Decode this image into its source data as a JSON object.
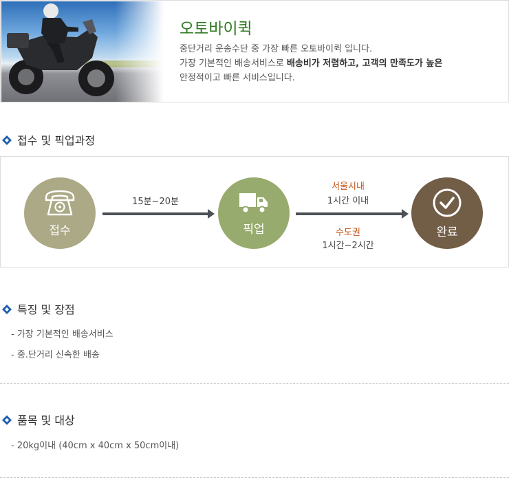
{
  "hero": {
    "title": "오토바이퀵",
    "desc_line1": "중단거리 운송수단 중 가장 빠른 오토바이퀵 입니다.",
    "desc_line2_plain": "가장 기본적인 배송서비스로 ",
    "desc_line2_bold": "배송비가 저렴하고, 고객의 만족도가 높은",
    "desc_line3": "안정적이고 빠른 서비스입니다."
  },
  "sections": {
    "process_title": "접수 및 픽업과정",
    "features_title": "특징 및 장점",
    "items_title": "품목 및 대상"
  },
  "process": {
    "steps": [
      {
        "label": "접수",
        "icon": "telephone-icon",
        "color": "#aba986"
      },
      {
        "label": "픽업",
        "icon": "truck-icon",
        "color": "#98ab6e"
      },
      {
        "label": "완료",
        "icon": "check-circle-icon",
        "color": "#725d47"
      }
    ],
    "arrow1_time": "15분~20분",
    "arrow2_top_title": "서울시내",
    "arrow2_top_time": "1시간 이내",
    "arrow2_bottom_title": "수도권",
    "arrow2_bottom_time": "1시간~2시간"
  },
  "features": [
    "- 가장 기본적인 배송서비스",
    "- 중.단거리 신속한 배송"
  ],
  "items": [
    "- 20kg이내 (40cm x 40cm x 50cm이내)"
  ],
  "colors": {
    "title_green": "#2f7a22",
    "accent_blue": "#1f5fae",
    "orange": "#c4571a",
    "arrow": "#4b5157"
  }
}
